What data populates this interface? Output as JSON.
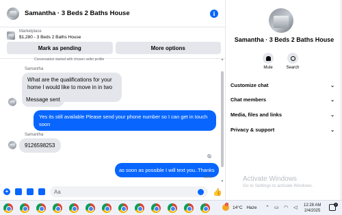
{
  "chat": {
    "title": "Samantha · 3 Beds 2 Baths House",
    "marketplace": {
      "label": "Marketplace",
      "item": "$1,280 - 3 Beds 2 Baths House",
      "mark_pending_label": "Mark as pending",
      "more_options_label": "More options"
    },
    "system_note": "Conversation started with chosen seller profile",
    "messages": [
      {
        "sender": "Samantha",
        "text": "What are the qualifications for your home I would like to move in in two weeks",
        "direction": "in"
      },
      {
        "sender": "",
        "text": "Message sent",
        "direction": "in"
      },
      {
        "sender": "",
        "text": "Yes its still available Please send your phone number so I can get in touch soon",
        "direction": "out"
      },
      {
        "sender": "Samantha",
        "text": "9126598253",
        "direction": "in"
      },
      {
        "sender": "",
        "text": "as soon as possible I will text you..Thanks",
        "direction": "out"
      }
    ],
    "sent_status": "Sent",
    "composer": {
      "placeholder": "Aa"
    }
  },
  "profile": {
    "name": "Samantha · 3 Beds 2 Baths House",
    "actions": [
      {
        "label": "Mute",
        "icon": "bell-icon"
      },
      {
        "label": "Search",
        "icon": "search-icon"
      }
    ],
    "menu": [
      {
        "label": "Customize chat"
      },
      {
        "label": "Chat members"
      },
      {
        "label": "Media, files and links"
      },
      {
        "label": "Privacy & support"
      }
    ]
  },
  "watermark": {
    "title": "Activate Windows",
    "subtitle": "Go to Settings to activate Windows."
  },
  "taskbar": {
    "app_count": 13,
    "app_icon": "chrome-icon",
    "weather": {
      "temp": "14°C",
      "condition": "Haze",
      "badge": "1"
    },
    "clock": {
      "time": "12:28 AM",
      "date": "2/4/2025"
    },
    "notification_badge": "2"
  },
  "colors": {
    "accent": "#0866ff",
    "incoming_bubble": "#e4e6eb",
    "taskbar": "#eef2f8"
  }
}
